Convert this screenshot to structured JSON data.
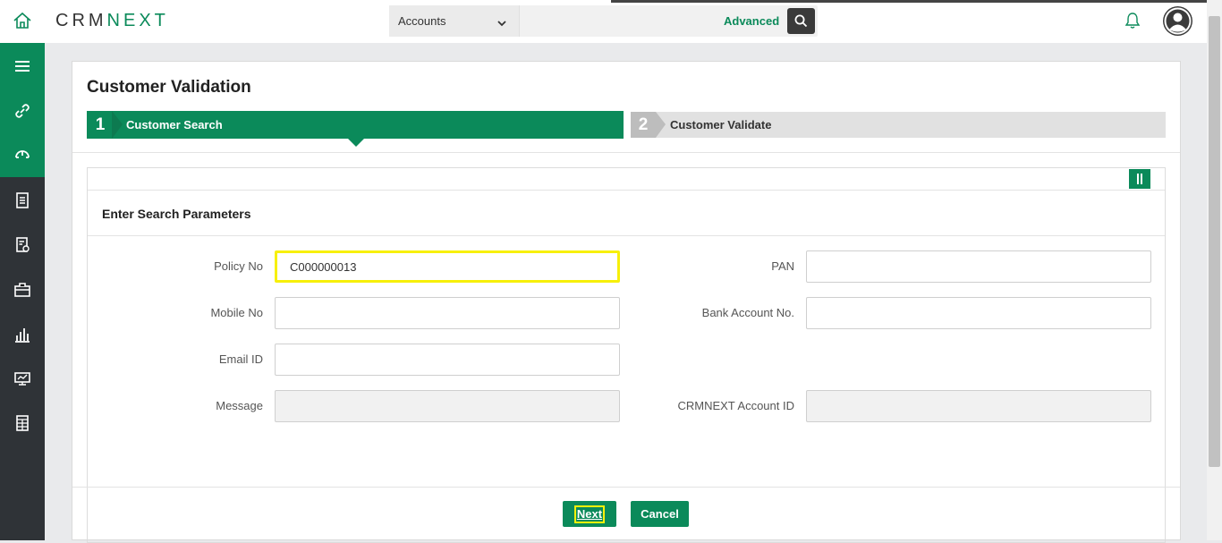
{
  "header": {
    "logo_text": "CRMNEXT",
    "module_selected": "Accounts",
    "search_placeholder": "",
    "advanced_label": "Advanced"
  },
  "sidebar": {
    "items": [
      "menu-icon",
      "link-icon",
      "dashboard-icon",
      "clipboard-icon",
      "report-icon",
      "briefcase-icon",
      "analytics-icon",
      "presentation-icon",
      "ledger-icon"
    ]
  },
  "page": {
    "title": "Customer Validation",
    "steps": [
      {
        "number": "1",
        "label": "Customer Search"
      },
      {
        "number": "2",
        "label": "Customer Validate"
      }
    ],
    "section_title": "Enter Search Parameters"
  },
  "form": {
    "policy_no": {
      "label": "Policy No",
      "value": "C000000013"
    },
    "pan": {
      "label": "PAN",
      "value": ""
    },
    "mobile_no": {
      "label": "Mobile No",
      "value": ""
    },
    "bank_account_no": {
      "label": "Bank Account No.",
      "value": ""
    },
    "email_id": {
      "label": "Email ID",
      "value": ""
    },
    "message": {
      "label": "Message",
      "value": ""
    },
    "crmnext_account_id": {
      "label": "CRMNEXT Account ID",
      "value": ""
    }
  },
  "buttons": {
    "next": "Next",
    "cancel": "Cancel"
  },
  "colors": {
    "brand_green": "#0b8a5a",
    "sidebar_dark": "#2f3337",
    "highlight_yellow": "#f7f00a"
  }
}
